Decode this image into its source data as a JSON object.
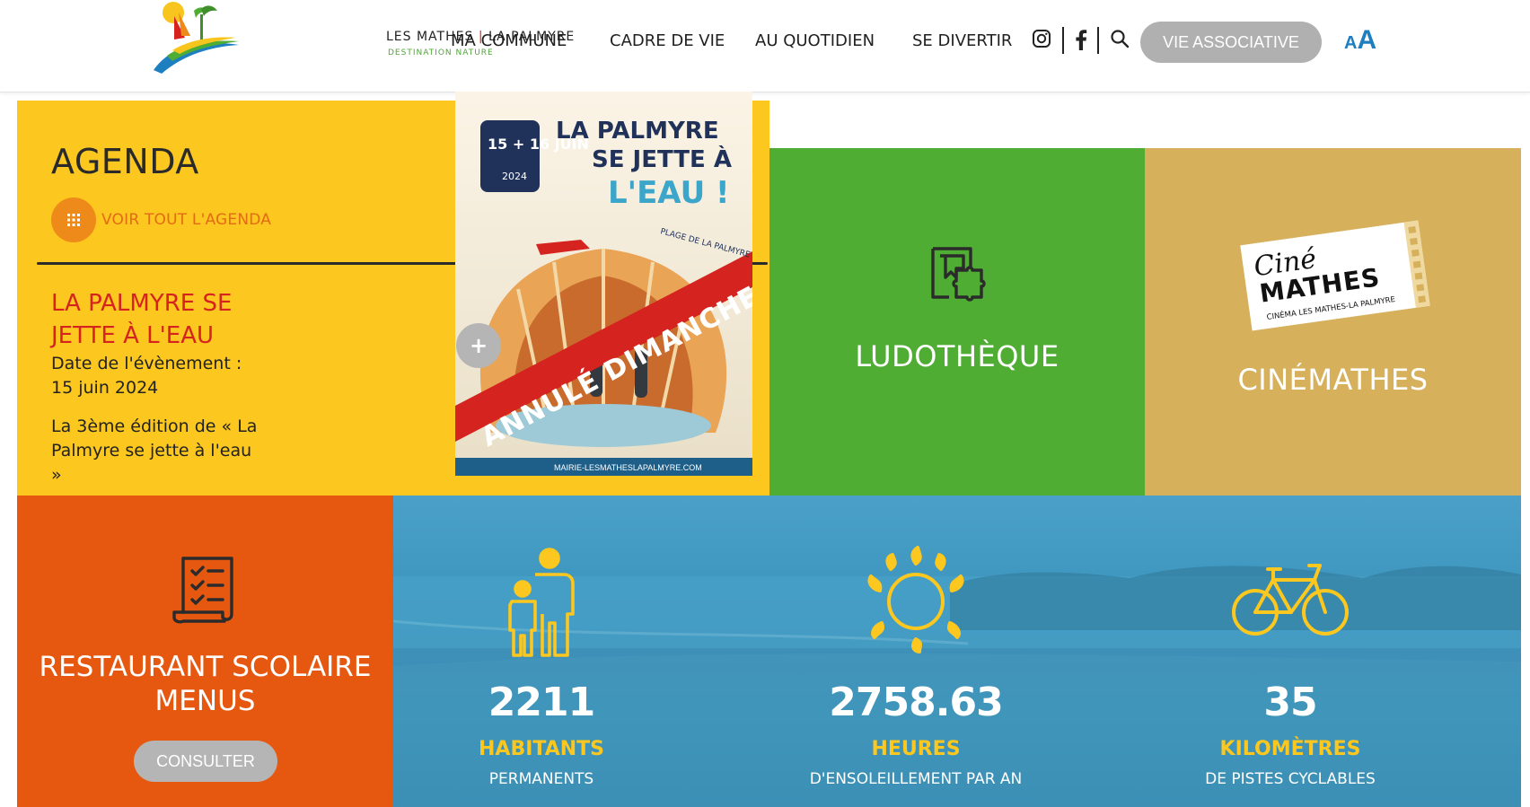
{
  "header": {
    "logo": {
      "name": "LES MATHES",
      "separator": "|",
      "name2": "LA PALMYRE",
      "tagline": "DESTINATION NATURE"
    },
    "nav": [
      "MA COMMUNE",
      "CADRE DE VIE",
      "AU QUOTIDIEN",
      "SE DIVERTIR"
    ],
    "social_icons": [
      "instagram-icon",
      "facebook-icon",
      "search-icon"
    ],
    "assoc_button": "VIE ASSOCIATIVE",
    "font_size_toggle": {
      "small": "A",
      "big": "A"
    }
  },
  "agenda": {
    "title": "AGENDA",
    "link": "VOIR TOUT L'AGENDA",
    "event": {
      "title": "LA PALMYRE SE JETTE À L'EAU",
      "date_label": "Date de l'évènement :",
      "date": "15 juin 2024",
      "description": "La 3ème édition de « La Palmyre se jette à l'eau »"
    },
    "poster": {
      "dates": "15 + 16 JUIN",
      "year": "2024",
      "title_line1": "LA PALMYRE",
      "title_line2": "SE JETTE À",
      "title_line3": "L'EAU !",
      "place": "PLAGE DE LA PALMYRE",
      "banner": "ANNULÉ DIMANCHE",
      "url": "MAIRIE-LESMATHESLAPALMYRE.COM"
    },
    "more_button": "+"
  },
  "tiles": {
    "ludo": "LUDOTHÈQUE",
    "cine": "CINÉMATHES",
    "cine_logo": {
      "line1": "Ciné",
      "line2": "MATHES",
      "line3": "CINÉMA LES MATHES-LA PALMYRE"
    }
  },
  "resto": {
    "title_line1": "RESTAURANT SCOLAIRE",
    "title_line2": "MENUS",
    "button": "CONSULTER"
  },
  "stats": [
    {
      "value": "2211",
      "unit": "HABITANTS",
      "sub": "PERMANENTS",
      "icon": "family-icon"
    },
    {
      "value": "2758.63",
      "unit": "HEURES",
      "sub": "D'ENSOLEILLEMENT PAR AN",
      "icon": "sun-icon"
    },
    {
      "value": "35",
      "unit": "KILOMÈTRES",
      "sub": "DE PISTES CYCLABLES",
      "icon": "bicycle-icon"
    }
  ],
  "colors": {
    "yellow": "#fcc71e",
    "green": "#50ad33",
    "sand": "#d6b05b",
    "orange": "#e6580f",
    "blue": "#3e8fb7",
    "red": "#d5231f"
  }
}
